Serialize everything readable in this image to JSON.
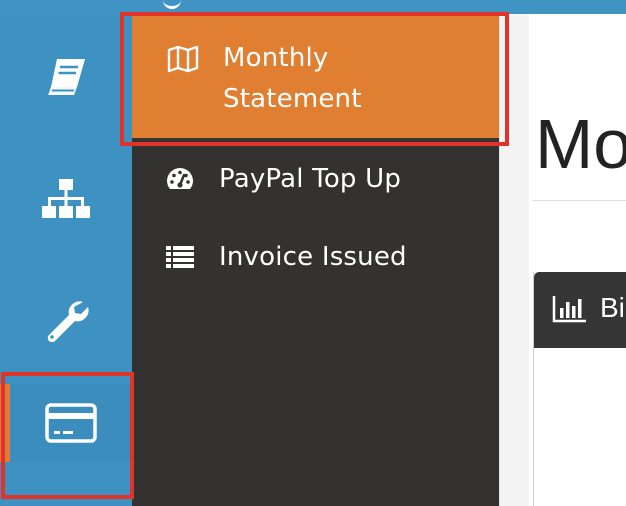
{
  "colors": {
    "rail_bg": "#3e92c2",
    "submenu_bg": "#343230",
    "active_item_bg": "#e07f31",
    "highlight_border": "#e0342a",
    "panel_header_bg": "#353535"
  },
  "rail": {
    "items": [
      {
        "icon": "book-icon",
        "active": false
      },
      {
        "icon": "sitemap-icon",
        "active": false
      },
      {
        "icon": "wrench-icon",
        "active": false
      },
      {
        "icon": "credit-card-icon",
        "active": true
      }
    ]
  },
  "submenu": {
    "items": [
      {
        "label_line1": "Monthly",
        "label_line2": "Statement",
        "icon": "map-icon",
        "active": true
      },
      {
        "label": "PayPal Top Up",
        "icon": "dashboard-icon",
        "active": false
      },
      {
        "label": "Invoice Issued",
        "icon": "list-icon",
        "active": false
      }
    ]
  },
  "main": {
    "page_title": "Mo",
    "panel": {
      "title": "Bi",
      "icon": "bar-chart-icon"
    }
  }
}
